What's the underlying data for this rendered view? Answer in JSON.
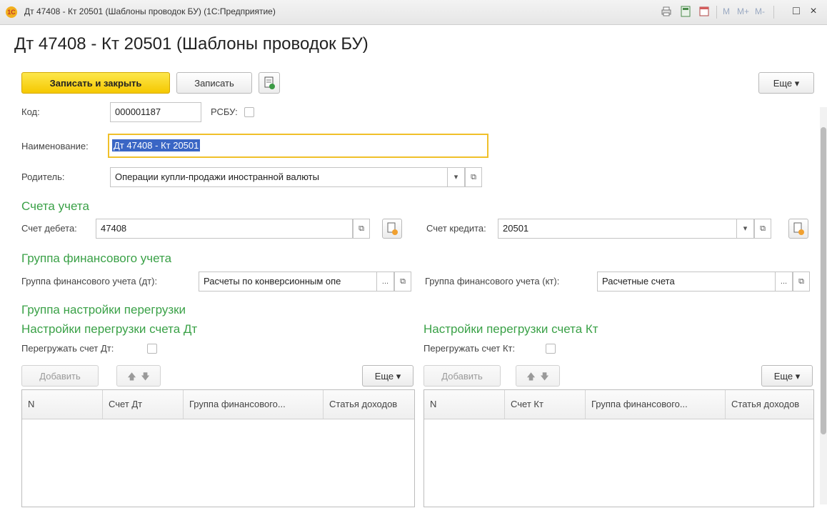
{
  "window": {
    "title": "Дт 47408 - Кт 20501 (Шаблоны проводок БУ) (1С:Предприятие)",
    "logo_text": "1C",
    "m_buttons": [
      "M",
      "M+",
      "M-"
    ],
    "maximize_glyph": "□",
    "close_glyph": "×"
  },
  "form": {
    "title": "Дт 47408 - Кт 20501 (Шаблоны проводок БУ)",
    "save_close_label": "Записать и закрыть",
    "save_label": "Записать",
    "more_label": "Еще ▾"
  },
  "fields": {
    "code_label": "Код:",
    "code_value": "000001187",
    "rsbu_label": "РСБУ:",
    "name_label": "Наименование:",
    "name_value": "Дт 47408 - Кт 20501",
    "parent_label": "Родитель:",
    "parent_value": "Операции купли-продажи иностранной валюты"
  },
  "accounts": {
    "section_title": "Счета учета",
    "debit_label": "Счет дебета:",
    "debit_value": "47408",
    "credit_label": "Счет кредита:",
    "credit_value": "20501"
  },
  "fin_group": {
    "section_title": "Группа финансового учета",
    "dt_label": "Группа финансового учета (дт):",
    "dt_value": "Расчеты по конверсионным опе",
    "kt_label": "Группа финансового учета (кт):",
    "kt_value": "Расчетные счета",
    "ellipsis": "..."
  },
  "reload": {
    "group_title": "Группа настройки перегрузки",
    "dt": {
      "title": "Настройки перегрузки счета Дт",
      "checkbox_label": "Перегружать счет Дт:",
      "add_label": "Добавить",
      "more_label": "Еще ▾",
      "columns": [
        "N",
        "Счет Дт",
        "Группа финансового...",
        "Статья доходов"
      ]
    },
    "kt": {
      "title": "Настройки перегрузки счета Кт",
      "checkbox_label": "Перегружать счет Кт:",
      "add_label": "Добавить",
      "more_label": "Еще ▾",
      "columns": [
        "N",
        "Счет Кт",
        "Группа финансового...",
        "Статья доходов"
      ]
    }
  },
  "glyphs": {
    "dropdown": "▾",
    "open": "⧉",
    "up": "🡅",
    "down": "🡇"
  }
}
